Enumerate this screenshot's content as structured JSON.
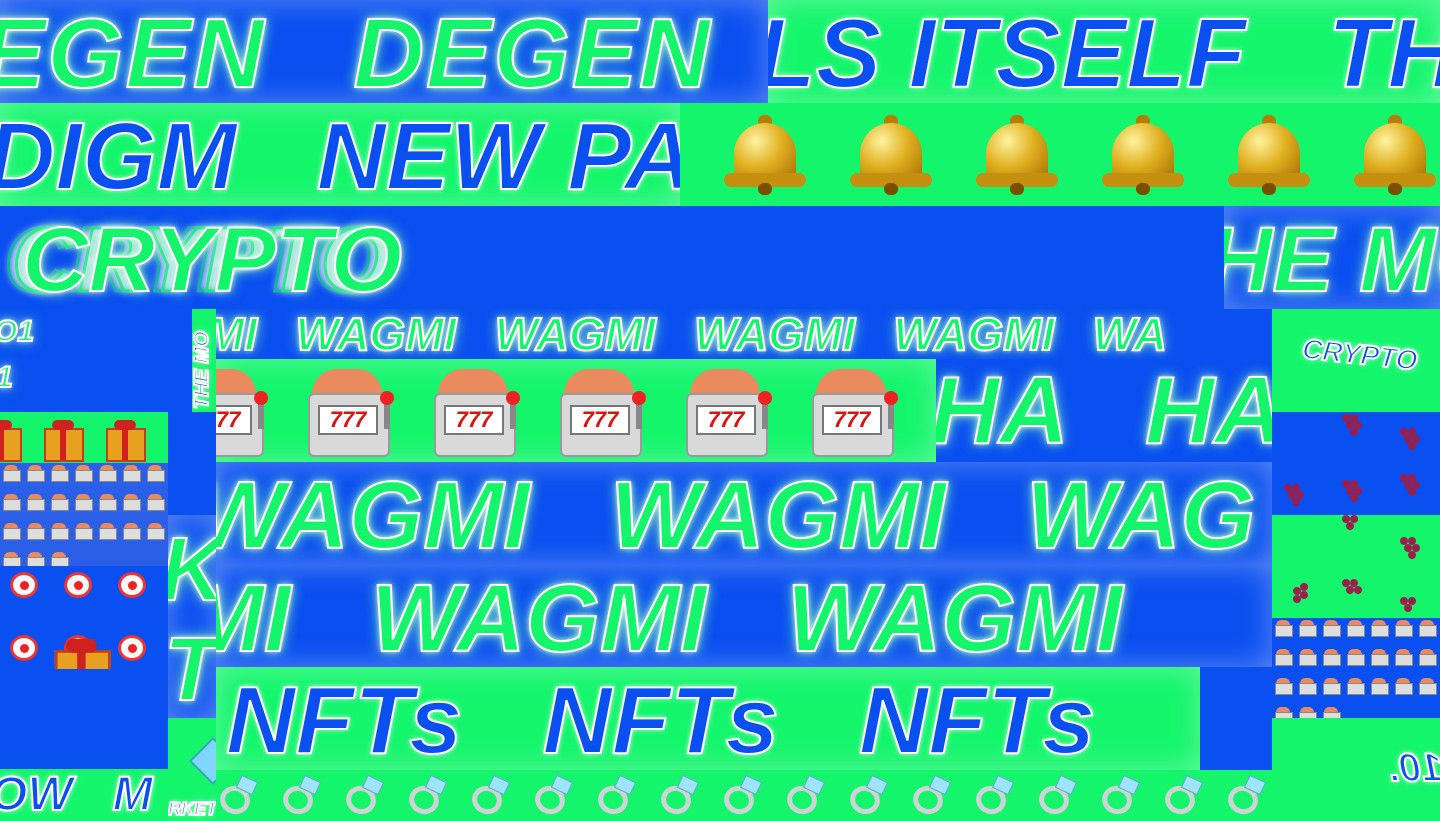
{
  "bands": {
    "r1_degen": "EGEN   DEGEN",
    "r1_itself": "LS ITSELF   TH",
    "r2_paradigm": "DIGM   NEW PA",
    "r3_crypto": "CRYPTO",
    "r3_moon": "HE MO",
    "r4_wagmi": "MI   WAGMI   WAGMI   WAGMI   WAGMI   WA",
    "r4_moon_vertical": "THE MO",
    "r5_haha": "HA   HA",
    "r6_wagmi": "WAGMI   WAGMI   WAG",
    "r7_wagmi": "MI   WAGMI   WAGMI",
    "r8_nfts": "NFTs   NFTs   NFTs",
    "r9_row": "OW   M",
    "r9_market": "RKET",
    "side_crypto": "CRYPTO",
    "side_frag_k": "K",
    "side_frag_t": "T",
    "side_frag_top_left": "O1",
    "side_frag_top_left2": "1",
    "side_frag_right_bottom": "10."
  },
  "emoji": {
    "bell": "bell-icon",
    "slot": "slot-machine-icon",
    "ring": "ring-icon",
    "gift": "gift-icon",
    "clown": "clown-face-icon",
    "grapes": "grapes-icon"
  },
  "colors": {
    "blue": "#0a4ff0",
    "green": "#14f56c",
    "white": "#ffffff"
  }
}
